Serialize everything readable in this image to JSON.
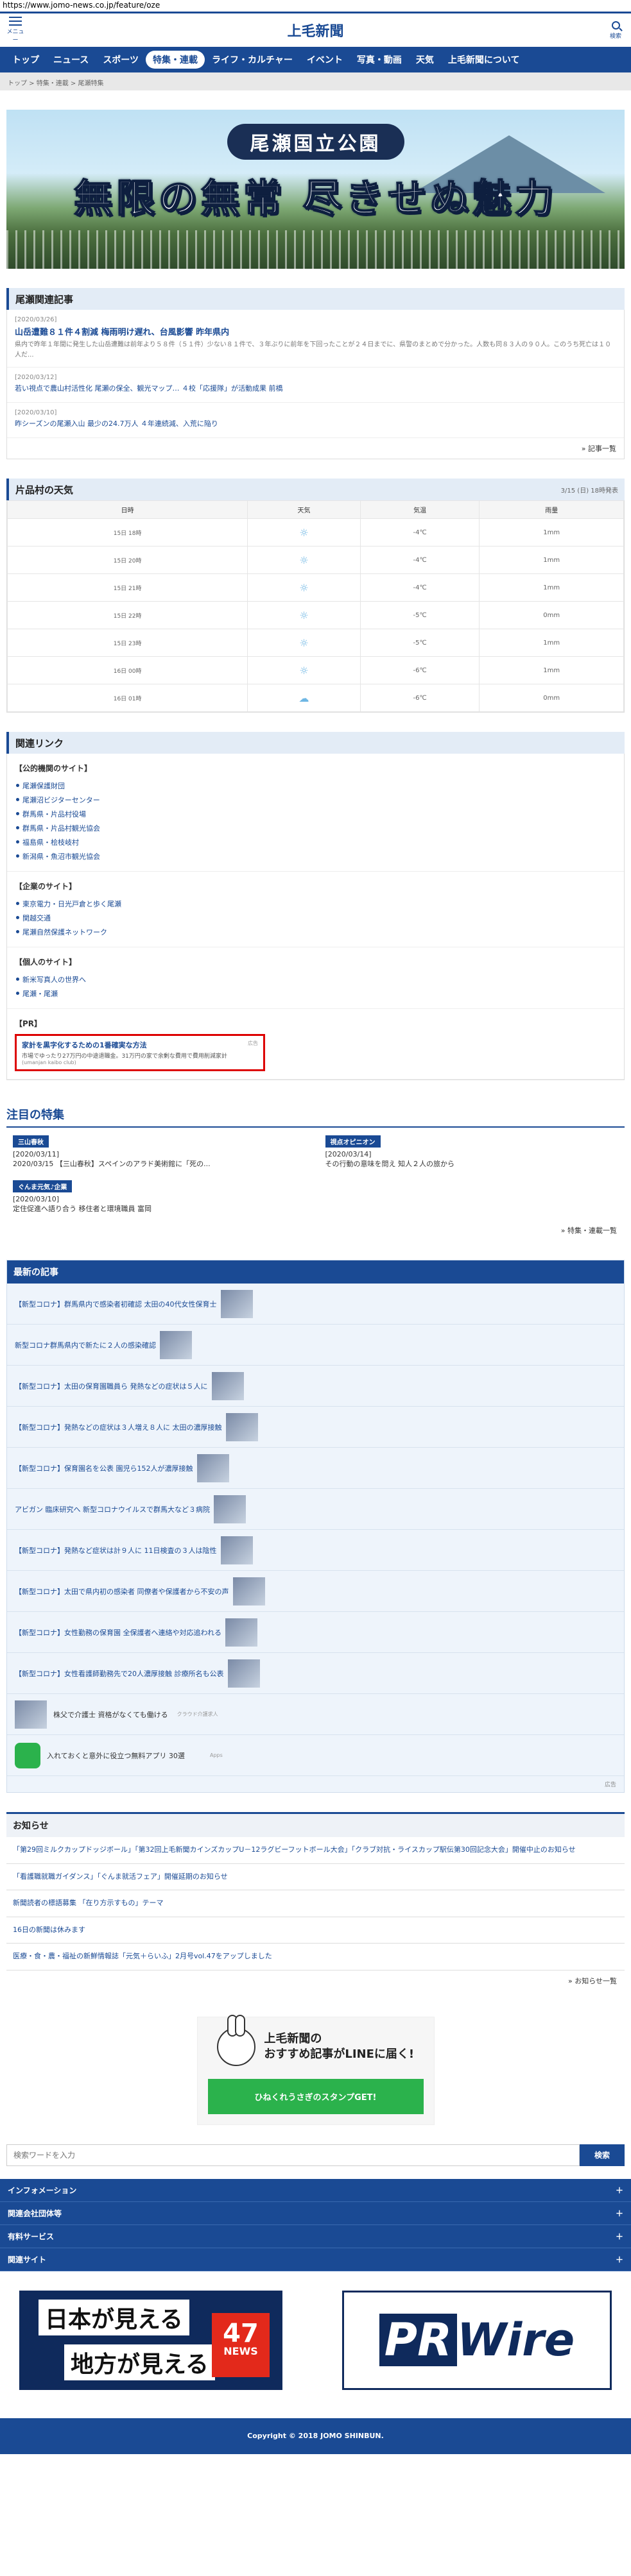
{
  "url": "https://www.jomo-news.co.jp/feature/oze",
  "header": {
    "logo": "上毛新聞",
    "menu_label": "メニュー",
    "search_label": "検索"
  },
  "nav": [
    "トップ",
    "ニュース",
    "スポーツ",
    "特集・連載",
    "ライフ・カルチャー",
    "イベント",
    "写真・動画",
    "天気",
    "上毛新聞について"
  ],
  "breadcrumb": "トップ > 特集・連載 > 尾瀬特集",
  "hero": {
    "subtitle": "尾瀬国立公園",
    "title": "無限の無常 尽きせぬ魅力"
  },
  "related_news": {
    "title": "尾瀬関連記事",
    "items": [
      {
        "date": "[2020/03/26]",
        "title": "山岳遭難８１件４割減 梅雨明け遅れ、台風影響 昨年県内",
        "body": "県内で昨年１年間に発生した山岳遭難は前年より５８件（５１件）少ない８１件で、３年ぶりに前年を下回ったことが２４日までに、県警のまとめで分かった。人数も同８３人の９０人。このうち死亡は１０人だ..."
      },
      {
        "date": "[2020/03/12]",
        "title": "若い視点で農山村活性化 尾瀬の保全、観光マップ… ４校「応援隊」が活動成果 前橋",
        "body": ""
      },
      {
        "date": "[2020/03/10]",
        "title": "昨シーズンの尾瀬入山 最少の24.7万人 ４年連続減、入荒に陥り",
        "body": ""
      }
    ],
    "more": "記事一覧"
  },
  "weather": {
    "title": "片品村の天気",
    "updated": "3/15 (日) 18時発表",
    "headers": [
      "日時",
      "天気",
      "気温",
      "雨量"
    ],
    "rows": [
      [
        "15日 18時",
        "☼",
        "-4℃",
        "1mm"
      ],
      [
        "15日 20時",
        "☼",
        "-4℃",
        "1mm"
      ],
      [
        "15日 21時",
        "☼",
        "-4℃",
        "1mm"
      ],
      [
        "15日 22時",
        "☼",
        "-5℃",
        "0mm"
      ],
      [
        "15日 23時",
        "☼",
        "-5℃",
        "1mm"
      ],
      [
        "16日 00時",
        "☼",
        "-6℃",
        "1mm"
      ],
      [
        "16日 01時",
        "☁",
        "-6℃",
        "0mm"
      ]
    ]
  },
  "links": {
    "title": "関連リンク",
    "groups": [
      {
        "name": "【公的機関のサイト】",
        "items": [
          "尾瀬保護財団",
          "尾瀬沼ビジターセンター",
          "群馬県・片品村役場",
          "群馬県・片品村観光協会",
          "福島県・桧枝岐村",
          "新潟県・魚沼市観光協会"
        ]
      },
      {
        "name": "【企業のサイト】",
        "items": [
          "東京電力・日光戸倉と歩く尾瀬",
          "関越交通",
          "尾瀬自然保護ネットワーク"
        ]
      },
      {
        "name": "【個人のサイト】",
        "items": [
          "新米写真人の世界へ",
          "尾瀬・尾瀬"
        ]
      }
    ],
    "pr_label": "【PR】",
    "pr": {
      "title": "家計を黒字化するための1番確実な方法",
      "sub": "市場でゆったり27万円の中途退職金。31万円の家で余剰な費用で費用削減家計",
      "credit": "(umanjan kaibo club)",
      "ad": "広告"
    }
  },
  "featured": {
    "title": "注目の特集",
    "items": [
      {
        "tag": "三山春秋",
        "date": "[2020/03/11]",
        "text": "2020/03/15 【三山春秋】スペインのアラド美術館に「死の..."
      },
      {
        "tag": "視点オピニオン",
        "date": "[2020/03/14]",
        "text": "その行動の意味を問え 知人２人の旅から"
      },
      {
        "tag": "ぐんま元気♪企業",
        "date": "[2020/03/10]",
        "text": "定住促進へ語り合う 移住者と環境職員 富岡"
      }
    ],
    "more": "特集・連載一覧"
  },
  "latest": {
    "title": "最新の記事",
    "items": [
      "【新型コロナ】群馬県内で感染者初確認 太田の40代女性保育士",
      "新型コロナ群馬県内で新たに２人の感染確認",
      "【新型コロナ】太田の保育園職員ら 発熱などの症状は５人に",
      "【新型コロナ】発熱などの症状は３人増え８人に 太田の濃厚接触",
      "【新型コロナ】保育園名を公表 園児ら152人が濃厚接触",
      "アビガン 臨床研究へ 新型コロナウイルスで群馬大など３病院",
      "【新型コロナ】発熱など症状は計９人に 11日検査の３人は陰性",
      "【新型コロナ】太田で県内初の感染者 同僚者や保護者から不安の声",
      "【新型コロナ】女性勤務の保育園 全保護者へ連絡や対応追われる",
      "【新型コロナ】女性看護師勤務先で20人濃厚接触 診療所名も公表"
    ],
    "ads": [
      {
        "text": "株父で介護士 資格がなくても働ける",
        "small": "クラウド介護求人"
      },
      {
        "text": "入れておくと意外に役立つ無料アプリ 30選",
        "small": "Apps"
      }
    ],
    "ad": "広告"
  },
  "notice": {
    "title": "お知らせ",
    "items": [
      "「第29回ミルクカップドッジボール」「第32回上毛新聞カインズカップU－12ラグビーフットボール大会」「クラブ対抗・ライスカップ駅伝第30回記念大会」開催中止のお知らせ",
      "「看護職就職ガイダンス」「ぐんま就活フェア」開催延期のお知らせ",
      "新聞読者の標語募集 「在り方示すもの」テーマ",
      "16日の新聞は休みます",
      "医療・食・農・福祉の新鮮情報誌「元気＋らいふ」2月号vol.47をアップしました"
    ],
    "more": "お知らせ一覧"
  },
  "line": {
    "title1": "上毛新聞の",
    "title2": "おすすめ記事がLINEに届く!",
    "button": "ひねくれうさぎのスタンプGET!"
  },
  "search": {
    "placeholder": "検索ワードを入力",
    "button": "検索"
  },
  "accordion": [
    "インフォメーション",
    "関連会社団体等",
    "有料サービス",
    "関連サイト"
  ],
  "banners": {
    "b47_line1": "日本が見える",
    "b47_line2": "地方が見える",
    "b47_num": "47",
    "b47_news": "NEWS",
    "prwire_a": "PR",
    "prwire_b": "Wire"
  },
  "footer": "Copyright © 2018 JOMO SHINBUN."
}
